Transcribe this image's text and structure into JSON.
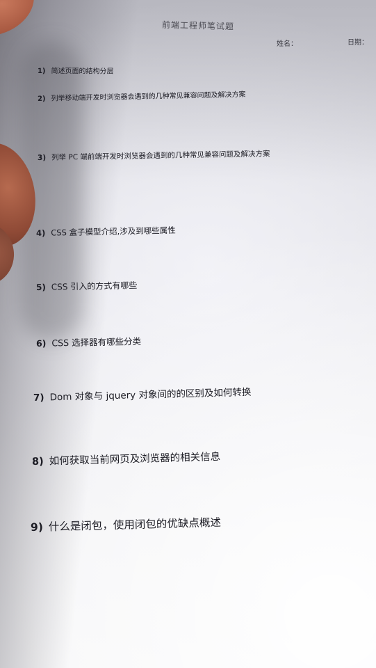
{
  "header": {
    "title": "前端工程师笔试题",
    "name_label": "姓名：",
    "date_label": "日期："
  },
  "questions": [
    {
      "num": "1)",
      "text": "简述页面的结构分层"
    },
    {
      "num": "2)",
      "text": "列举移动端开发时浏览器会遇到的几种常见兼容问题及解决方案"
    },
    {
      "num": "3)",
      "text": "列举 PC 端前端开发时浏览器会遇到的几种常见兼容问题及解决方案"
    },
    {
      "num": "4)",
      "text": "CSS 盒子模型介绍,涉及到哪些属性"
    },
    {
      "num": "5)",
      "text": "CSS 引入的方式有哪些"
    },
    {
      "num": "6)",
      "text": "CSS 选择器有哪些分类"
    },
    {
      "num": "7)",
      "text": "Dom 对象与 jquery 对象间的的区别及如何转换"
    },
    {
      "num": "8)",
      "text": "如何获取当前网页及浏览器的相关信息"
    },
    {
      "num": "9)",
      "text": "什么是闭包，使用闭包的优缺点概述"
    }
  ]
}
